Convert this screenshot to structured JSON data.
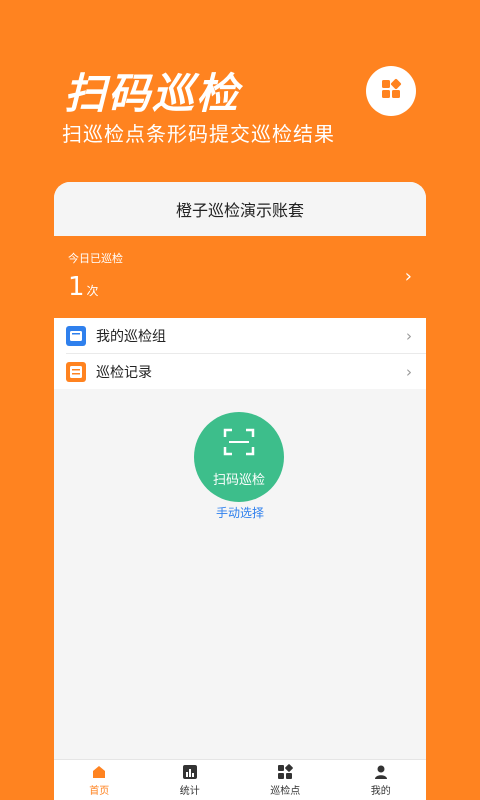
{
  "hero": {
    "title": "扫码巡检",
    "subtitle": "扫巡检点条形码提交巡检结果"
  },
  "card": {
    "account_title": "橙子巡检演示账套",
    "today": {
      "label": "今日已巡检",
      "count": "1",
      "unit": "次"
    },
    "menu": [
      {
        "label": "我的巡检组",
        "icon": "group-icon"
      },
      {
        "label": "巡检记录",
        "icon": "record-icon"
      }
    ],
    "scan": {
      "label": "扫码巡检"
    },
    "manual": {
      "label": "手动选择"
    }
  },
  "tabs": [
    {
      "label": "首页",
      "icon": "home-icon",
      "active": true
    },
    {
      "label": "统计",
      "icon": "stats-icon"
    },
    {
      "label": "巡检点",
      "icon": "grid-icon"
    },
    {
      "label": "我的",
      "icon": "user-icon"
    }
  ],
  "colors": {
    "primary": "#FF8320",
    "scan": "#3DBE8B",
    "link": "#2F80ED"
  }
}
